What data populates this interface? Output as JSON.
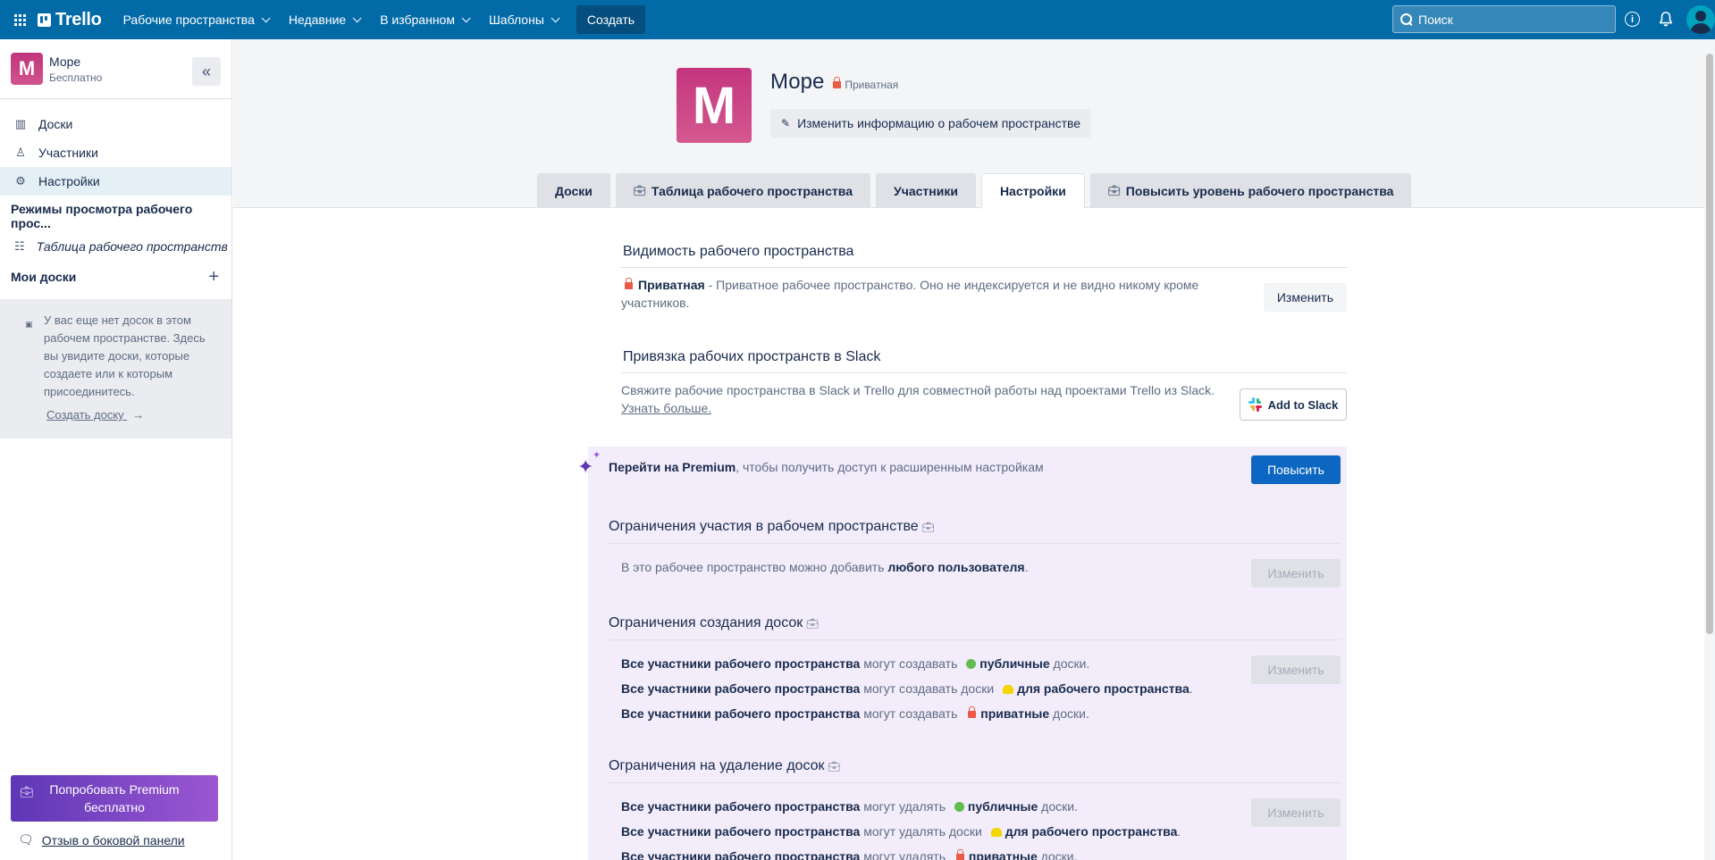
{
  "topbar": {
    "logo": "Trello",
    "nav": [
      "Рабочие пространства",
      "Недавние",
      "В избранном",
      "Шаблоны"
    ],
    "create": "Создать",
    "search_placeholder": "Поиск"
  },
  "sidebar": {
    "workspace_initial": "M",
    "workspace_name": "Море",
    "workspace_plan": "Бесплатно",
    "items": [
      {
        "label": "Доски",
        "icon": "board-icon"
      },
      {
        "label": "Участники",
        "icon": "person-icon"
      },
      {
        "label": "Настройки",
        "icon": "gear-icon"
      }
    ],
    "views_title": "Режимы просмотра рабочего прос...",
    "table_view": "Таблица рабочего пространств",
    "my_boards": "Мои доски",
    "empty_text": "У вас еще нет досок в этом рабочем пространстве. Здесь вы увидите доски, которые создаете или к которым присоединитесь.",
    "create_board": "Создать доску",
    "premium_button": "Попробовать Premium бесплатно",
    "feedback": "Отзыв о боковой панели"
  },
  "header": {
    "initial": "M",
    "name": "Море",
    "privacy": "Приватная",
    "edit_button": "Изменить информацию о рабочем пространстве",
    "tabs": [
      {
        "label": "Доски"
      },
      {
        "label": "Таблица рабочего пространства"
      },
      {
        "label": "Участники"
      },
      {
        "label": "Настройки"
      },
      {
        "label": "Повысить уровень рабочего пространства"
      }
    ]
  },
  "visibility": {
    "title": "Видимость рабочего пространства",
    "label": "Приватная",
    "text": " - Приватное рабочее пространство. Оно не индексируется и не видно никому кроме участников.",
    "button": "Изменить"
  },
  "slack": {
    "title": "Привязка рабочих пространств в Slack",
    "text": "Свяжите рабочие пространства в Slack и Trello для совместной работы над проектами Trello из Slack.",
    "learn_more": "Узнать больше.",
    "button": "Add to Slack"
  },
  "premium": {
    "bold": "Перейти на Premium",
    "text": ", чтобы получить доступ к расширенным настройкам",
    "button": "Повысить",
    "membership": {
      "title": "Ограничения участия в рабочем пространстве",
      "text_before": "В это рабочее пространство можно добавить ",
      "text_bold": "любого пользователя",
      "text_after": ".",
      "button": "Изменить"
    },
    "creation": {
      "title": "Ограничения создания досок",
      "who": "Все участники рабочего пространства",
      "row1_mid": " могут создавать ",
      "row1_bold": "публичные",
      "row1_end": " доски.",
      "row2_mid": " могут создавать доски ",
      "row2_bold": "для рабочего пространства",
      "row2_end": ".",
      "row3_mid": " могут создавать ",
      "row3_bold": "приватные",
      "row3_end": " доски.",
      "button": "Изменить"
    },
    "deletion": {
      "title": "Ограничения на удаление досок",
      "who": "Все участники рабочего пространства",
      "row1_mid": " могут удалять ",
      "row1_bold": "публичные",
      "row1_end": " доски.",
      "row2_mid": " могут удалять доски ",
      "row2_bold": "для рабочего пространства",
      "row2_end": ".",
      "row3_mid": " могут удалять ",
      "row3_bold": "приватные",
      "row3_end": " доски.",
      "button": "Изменить"
    }
  }
}
